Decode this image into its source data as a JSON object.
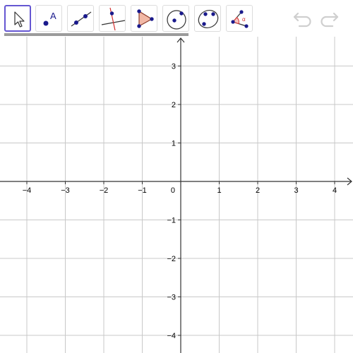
{
  "toolbar": {
    "tools": [
      {
        "name": "move-tool",
        "icon": "arrow-pointer-icon"
      },
      {
        "name": "point-tool",
        "icon": "point-icon",
        "letter": "A"
      },
      {
        "name": "line-tool",
        "icon": "line-through-two-points-icon"
      },
      {
        "name": "perpendicular-line-tool",
        "icon": "perpendicular-line-icon"
      },
      {
        "name": "polygon-tool",
        "icon": "polygon-icon"
      },
      {
        "name": "circle-tool",
        "icon": "circle-with-center-icon"
      },
      {
        "name": "circle-through-three-points-tool",
        "icon": "circle-through-three-points-icon"
      },
      {
        "name": "angle-tool",
        "icon": "angle-icon",
        "letter": "α"
      }
    ],
    "selected_tool": "move-tool",
    "undo_icon": "undo-icon",
    "redo_icon": "redo-icon"
  },
  "graphics": {
    "x_ticks": [
      "−4",
      "−3",
      "−2",
      "−1",
      "0",
      "1",
      "2",
      "3",
      "4"
    ],
    "y_ticks_positive": [
      "3",
      "2",
      "1"
    ],
    "y_ticks_negative": [
      "−1",
      "−2",
      "−3",
      "−4"
    ],
    "grid": true
  },
  "colors": {
    "accent": "#6557d2",
    "point": "#1a1a8c",
    "red": "#d32f2f",
    "grid": "#c8c8c8",
    "icon_disabled": "#cfcfcf"
  }
}
